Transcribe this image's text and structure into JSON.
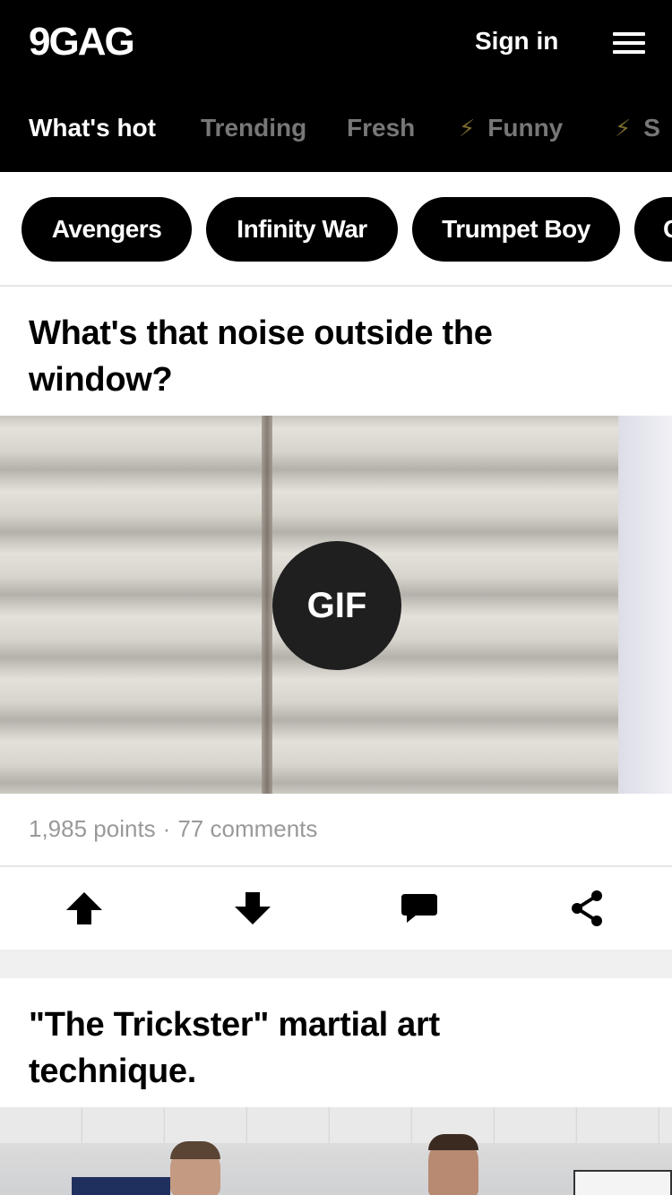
{
  "header": {
    "logo": "9GAG",
    "sign_in": "Sign in",
    "menu_icon": "hamburger-menu-icon"
  },
  "nav": {
    "tabs": [
      {
        "label": "What's hot",
        "active": true
      },
      {
        "label": "Trending",
        "active": false
      },
      {
        "label": "Fresh",
        "active": false
      },
      {
        "label": "Funny",
        "active": false,
        "icon": "lightning-bolt-icon"
      },
      {
        "label": "S",
        "active": false,
        "icon": "lightning-bolt-icon"
      }
    ]
  },
  "tags": [
    "Avengers",
    "Infinity War",
    "Trumpet Boy",
    "C"
  ],
  "posts": [
    {
      "title": "What's that noise outside the window?",
      "title_line1": "What's that noise outside the",
      "title_line2": "window?",
      "badge": "GIF",
      "points": "1,985 points",
      "separator": "·",
      "comments": "77 comments",
      "actions": [
        "upvote-icon",
        "downvote-icon",
        "comment-icon",
        "share-icon"
      ]
    },
    {
      "title": "\"The Trickster\" martial art technique.",
      "title_line1": "\"The Trickster\" martial art",
      "title_line2": "technique."
    }
  ],
  "colors": {
    "header_bg": "#000000",
    "active_tab": "#ffffff",
    "inactive_tab": "#777777",
    "meta_text": "#999999",
    "bolt": "#7a6a2e"
  }
}
